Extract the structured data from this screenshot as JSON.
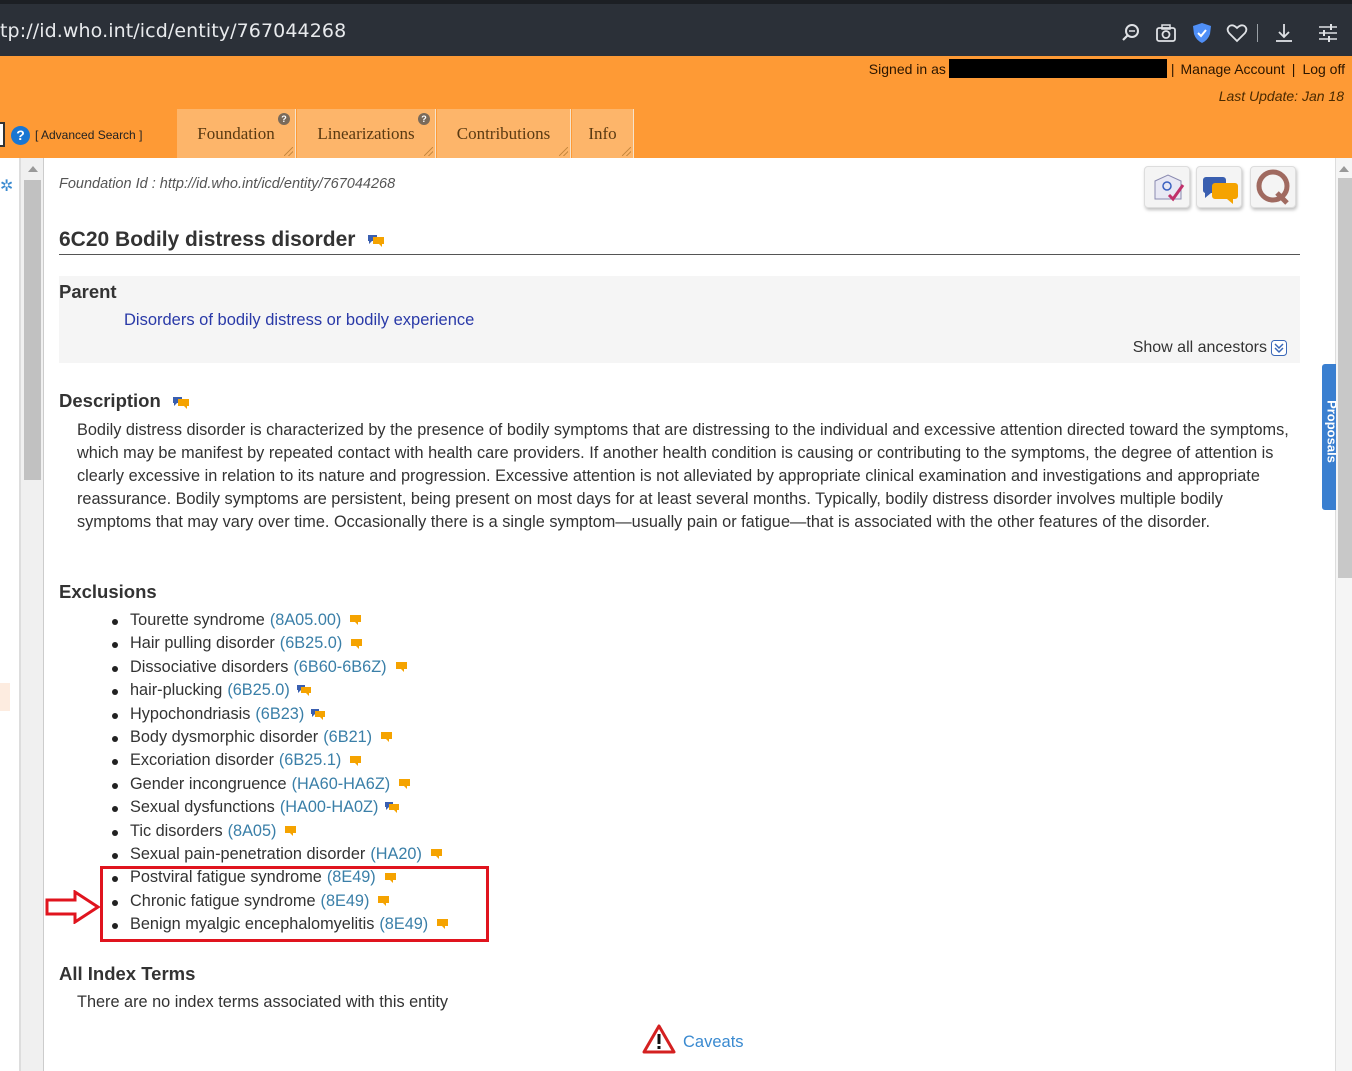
{
  "browser": {
    "url": "tp://id.who.int/icd/entity/767044268"
  },
  "header": {
    "signed_in_prefix": "Signed in as",
    "manage_account": "Manage Account",
    "log_off": "Log off",
    "separator": "|",
    "last_update": "Last Update: Jan 18",
    "advanced_search": "[ Advanced Search ]",
    "help_glyph": "?"
  },
  "tabs": [
    {
      "label": "Foundation",
      "has_help": true
    },
    {
      "label": "Linearizations",
      "has_help": true
    },
    {
      "label": "Contributions",
      "has_help": false
    },
    {
      "label": "Info",
      "has_help": false
    }
  ],
  "side_tab": {
    "label": "Proposals"
  },
  "entity": {
    "foundation_id": "Foundation Id : http://id.who.int/icd/entity/767044268",
    "title": "6C20 Bodily distress disorder"
  },
  "parent": {
    "heading": "Parent",
    "link": "Disorders of bodily distress or bodily experience",
    "show_ancestors": "Show all ancestors"
  },
  "description": {
    "heading": "Description",
    "text": "Bodily distress disorder is characterized by the presence of bodily symptoms that are distressing to the individual and excessive attention directed toward the symptoms, which may be manifest by repeated contact with health care providers. If another health condition is causing or contributing to the symptoms, the degree of attention is clearly excessive in relation to its nature and progression. Excessive attention is not alleviated by appropriate clinical examination and investigations and appropriate reassurance. Bodily symptoms are persistent, being present on most days for at least several months. Typically, bodily distress disorder involves multiple bodily symptoms that may vary over time. Occasionally there is a single symptom—usually pain or fatigue—that is associated with the other features of the disorder."
  },
  "exclusions": {
    "heading": "Exclusions",
    "items": [
      {
        "name": "Tourette syndrome",
        "code": "(8A05.00)",
        "bubble": "orange"
      },
      {
        "name": "Hair pulling disorder",
        "code": "(6B25.0)",
        "bubble": "orange"
      },
      {
        "name": "Dissociative disorders",
        "code": "(6B60-6B6Z)",
        "bubble": "orange"
      },
      {
        "name": "hair-plucking",
        "code": "(6B25.0)",
        "bubble": "multi"
      },
      {
        "name": "Hypochondriasis",
        "code": "(6B23)",
        "bubble": "multi"
      },
      {
        "name": "Body dysmorphic disorder",
        "code": "(6B21)",
        "bubble": "orange"
      },
      {
        "name": "Excoriation disorder",
        "code": "(6B25.1)",
        "bubble": "orange"
      },
      {
        "name": "Gender incongruence",
        "code": "(HA60-HA6Z)",
        "bubble": "orange"
      },
      {
        "name": "Sexual dysfunctions",
        "code": "(HA00-HA0Z)",
        "bubble": "multi"
      },
      {
        "name": "Tic disorders",
        "code": "(8A05)",
        "bubble": "orange"
      },
      {
        "name": "Sexual pain-penetration disorder",
        "code": "(HA20)",
        "bubble": "orange"
      },
      {
        "name": "Postviral fatigue syndrome",
        "code": "(8E49)",
        "bubble": "orange"
      },
      {
        "name": "Chronic fatigue syndrome",
        "code": "(8E49)",
        "bubble": "orange"
      },
      {
        "name": "Benign myalgic encephalomyelitis",
        "code": "(8E49)",
        "bubble": "orange"
      }
    ]
  },
  "index_terms": {
    "heading": "All Index Terms",
    "text": "There are no index terms associated with this entity"
  },
  "caveats": {
    "label": "Caveats"
  },
  "colors": {
    "header_orange": "#fe9a35",
    "tab_bg": "#fdb56a",
    "link_blue": "#2a3aa8",
    "code_blue": "#3a7fa8",
    "highlight_red": "#e0141e",
    "bubble_orange": "#f5a300"
  },
  "icons": [
    "search-icon",
    "camera-icon",
    "shield-icon",
    "heart-icon",
    "download-icon",
    "settings-icon",
    "help-icon",
    "feedback-icon",
    "comments-icon",
    "query-icon",
    "comment-bubble-icon",
    "warning-icon",
    "arrow-icon"
  ]
}
